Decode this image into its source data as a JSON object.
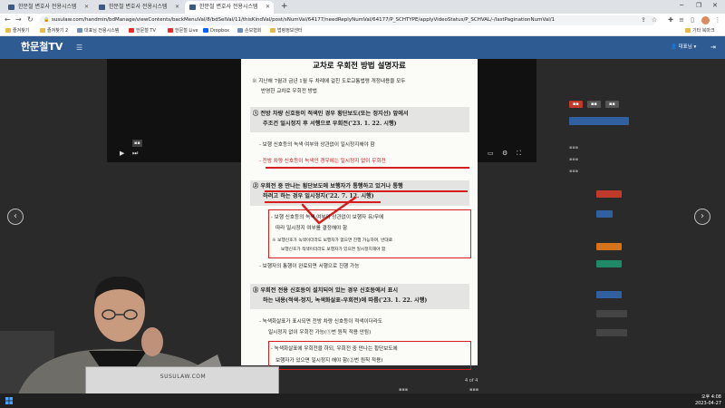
{
  "browser": {
    "tabs": [
      {
        "label": "한문철 변호사 전용시스템",
        "active": false
      },
      {
        "label": "한문철 변호사 전용시스템",
        "active": false
      },
      {
        "label": "한문철 변호사 전용시스템",
        "active": true
      }
    ],
    "new_tab": "+",
    "url": "susulaw.com/handmin/bdManage/viewContents/backMenuVal/8/bdSelVal/11/thisKindVal/post/sNumVal/64177/needReplyNumVal/64177/P_SCHTYPE/applyVideoStatus/P_SCHVAL/-/lastPaginationNumVal/1",
    "bookmarks": [
      {
        "label": "즐겨찾기",
        "icon": "folder"
      },
      {
        "label": "즐겨찾기 2",
        "icon": "folder"
      },
      {
        "label": "대표님 전용시스템",
        "icon": "site"
      },
      {
        "label": "한문철 TV",
        "icon": "youtube"
      },
      {
        "label": "한문철 Live",
        "icon": "youtube"
      },
      {
        "label": "Dropbox",
        "icon": "dropbox"
      },
      {
        "label": "손보협회",
        "icon": "site"
      },
      {
        "label": "법령정보센터",
        "icon": "folder"
      }
    ],
    "other_bookmarks": "기타 북마크"
  },
  "site": {
    "logo": "한문철TV",
    "user": "대표님"
  },
  "document": {
    "title": "교차로 우회전 방법 설명자료",
    "intro": [
      "※ 지난해 7월과 금년 1월 두 차례에 걸친 도로교통법령 개정내용을 모두",
      "반영한 교차로 우회전 방법"
    ],
    "sec1": {
      "head": [
        "① 전방 차량 신호등이 적색인 경우 횡단보도(또는 정지선) 앞에서",
        "주조건 일시정지 후 서행으로 우회전('23. 1. 22. 시행)"
      ],
      "items": [
        "- 보행 신호등의 녹색 여부와 상관없이 일시정지해야 함",
        "- 전방 차량 신호등이 녹색인 경우에는 일시정지 없이 우회전"
      ]
    },
    "sec2": {
      "head": [
        "② 우회전 중 만나는 횡단보도에 보행자가 통행하고 있거나 통행",
        "하려고 하는 경우 일시정지('22. 7. 12. 시행)"
      ],
      "items": [
        "- 보행 신호등의 녹색 여부와 상관없이 보행자 유/무에",
        "따라 일시정지 여부를 결정해야 함",
        "※ 보행신호가 녹색이더라도 보행자가 없으면 진행 가능하며, 반대로",
        "보행신호가 적색이더라도 보행자가 있으면 일시정지해야 함",
        "- 보행자의 통행이 완료되면 서행으로 진행 가능"
      ]
    },
    "sec3": {
      "head": [
        "③ 우회전 전용 신호등이 설치되어 있는 경우 신호등에서 표시",
        "하는 내용(적색-정지, 녹색화살표-우회전)에 따름('23. 1. 22. 시행)"
      ],
      "items": [
        "- 녹색화살표가 표시되면 전방 차량 신호등이 적색이더라도",
        "일시정지 없이 우회전 가능(①번 원칙 적용 안됨)",
        "- 녹색화살표에 우회전을 하되, 우회전 중 만나는 횡단보도에",
        "보행자가 있으면 일시정지 해야 함(②번 원칙 적용)"
      ]
    }
  },
  "pager": "4 of 4",
  "laptop_brand": "SUSULAW.COM",
  "clock": {
    "time": "오후 4:08",
    "date": "2023-04-27"
  },
  "colors": {
    "header": "#2f5b93",
    "highlight": "#d61e1e"
  }
}
